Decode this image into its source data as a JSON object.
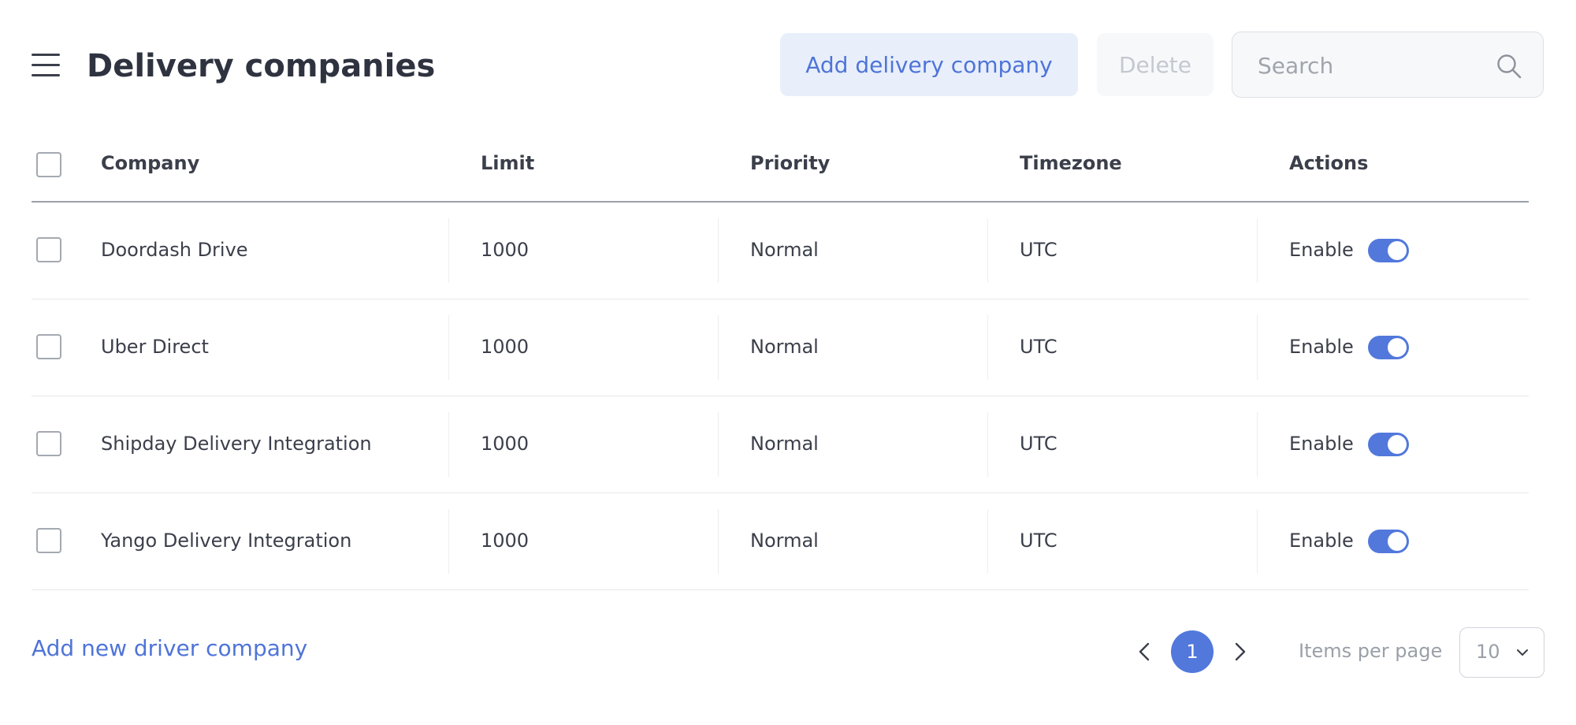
{
  "header": {
    "title": "Delivery companies",
    "add_button": "Add delivery company",
    "delete_button": "Delete",
    "search_placeholder": "Search"
  },
  "table": {
    "columns": {
      "company": "Company",
      "limit": "Limit",
      "priority": "Priority",
      "timezone": "Timezone",
      "actions": "Actions"
    },
    "rows": [
      {
        "company": "Doordash Drive",
        "limit": "1000",
        "priority": "Normal",
        "timezone": "UTC",
        "action_label": "Enable",
        "enabled": true
      },
      {
        "company": "Uber Direct",
        "limit": "1000",
        "priority": "Normal",
        "timezone": "UTC",
        "action_label": "Enable",
        "enabled": true
      },
      {
        "company": "Shipday Delivery Integration",
        "limit": "1000",
        "priority": "Normal",
        "timezone": "UTC",
        "action_label": "Enable",
        "enabled": true
      },
      {
        "company": "Yango Delivery Integration",
        "limit": "1000",
        "priority": "Normal",
        "timezone": "UTC",
        "action_label": "Enable",
        "enabled": true
      }
    ]
  },
  "footer": {
    "add_driver_link": "Add new driver company",
    "current_page": "1",
    "items_per_page_label": "Items per page",
    "items_per_page_value": "10"
  },
  "colors": {
    "accent": "#5278dc",
    "link": "#4f74d8",
    "soft_button_bg": "#e8effb",
    "text": "#3b3f4a"
  },
  "icons": {
    "menu": "hamburger-menu-icon",
    "search": "search-icon",
    "prev": "chevron-left-icon",
    "next": "chevron-right-icon",
    "dropdown": "chevron-down-icon"
  }
}
